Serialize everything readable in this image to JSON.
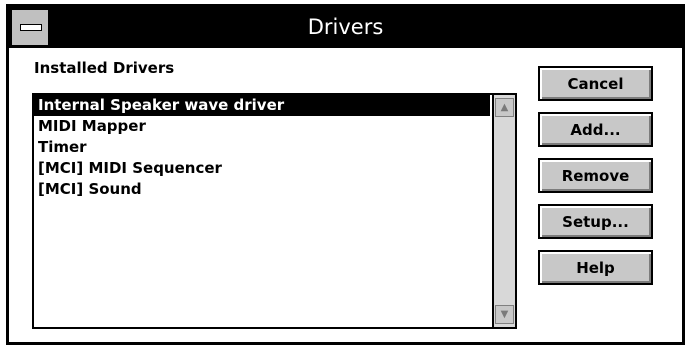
{
  "window": {
    "title": "Drivers"
  },
  "installed": {
    "label": "Installed Drivers",
    "items": [
      "Internal Speaker wave driver",
      "MIDI Mapper",
      "Timer",
      "[MCI] MIDI Sequencer",
      "[MCI] Sound"
    ],
    "selected_index": 0
  },
  "buttons": {
    "cancel": "Cancel",
    "add": "Add...",
    "remove": "Remove",
    "setup": "Setup...",
    "help": "Help"
  },
  "scrollbar": {
    "up_icon": "▲",
    "down_icon": "▼"
  },
  "colors": {
    "title_bg": "#000000",
    "button_face": "#c8c8c8",
    "selection": "#000000"
  }
}
